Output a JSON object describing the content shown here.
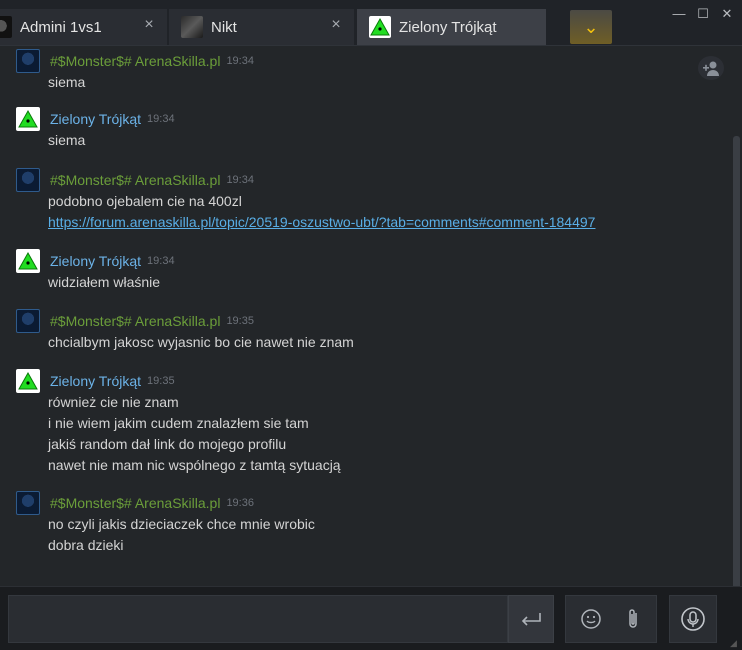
{
  "tabs": [
    {
      "label": "Admini 1vs1",
      "close": "×"
    },
    {
      "label": "Nikt",
      "close": "×"
    },
    {
      "label": "Zielony Trójkąt",
      "close": ""
    }
  ],
  "window_controls": {
    "minimize": "—",
    "maximize": "☐",
    "close": "✕"
  },
  "dropdown_glyph": "⌄",
  "messages": [
    {
      "sender": "#$Monster$# ArenaSkilla.pl",
      "time": "19:34",
      "lines": [
        "siema"
      ]
    },
    {
      "sender": "Zielony Trójkąt",
      "time": "19:34",
      "lines": [
        "siema"
      ]
    },
    {
      "sender": "#$Monster$# ArenaSkilla.pl",
      "time": "19:34",
      "lines": [
        "podobno ojebalem cie na 400zl"
      ],
      "link": "https://forum.arenaskilla.pl/topic/20519-oszustwo-ubt/?tab=comments#comment-184497"
    },
    {
      "sender": "Zielony Trójkąt",
      "time": "19:34",
      "lines": [
        "widziałem właśnie"
      ]
    },
    {
      "sender": "#$Monster$# ArenaSkilla.pl",
      "time": "19:35",
      "lines": [
        "chcialbym jakosc wyjasnic bo cie nawet nie znam"
      ]
    },
    {
      "sender": "Zielony Trójkąt",
      "time": "19:35",
      "lines": [
        "również cie nie znam",
        "i nie wiem jakim cudem znalazłem sie tam",
        "jakiś random dał link do mojego profilu",
        "nawet nie mam nic wspólnego z tamtą sytuacją"
      ]
    },
    {
      "sender": "#$Monster$# ArenaSkilla.pl",
      "time": "19:36",
      "lines": [
        "no czyli jakis dzieciaczek chce mnie wrobic",
        "dobra dzieki"
      ]
    }
  ],
  "composer": {
    "value": "",
    "placeholder": ""
  },
  "colors": {
    "monster_name": "#6b9e3a",
    "zielony_name": "#6cb3e8",
    "link": "#59aee6",
    "accent_dropdown": "#f4c20d"
  }
}
